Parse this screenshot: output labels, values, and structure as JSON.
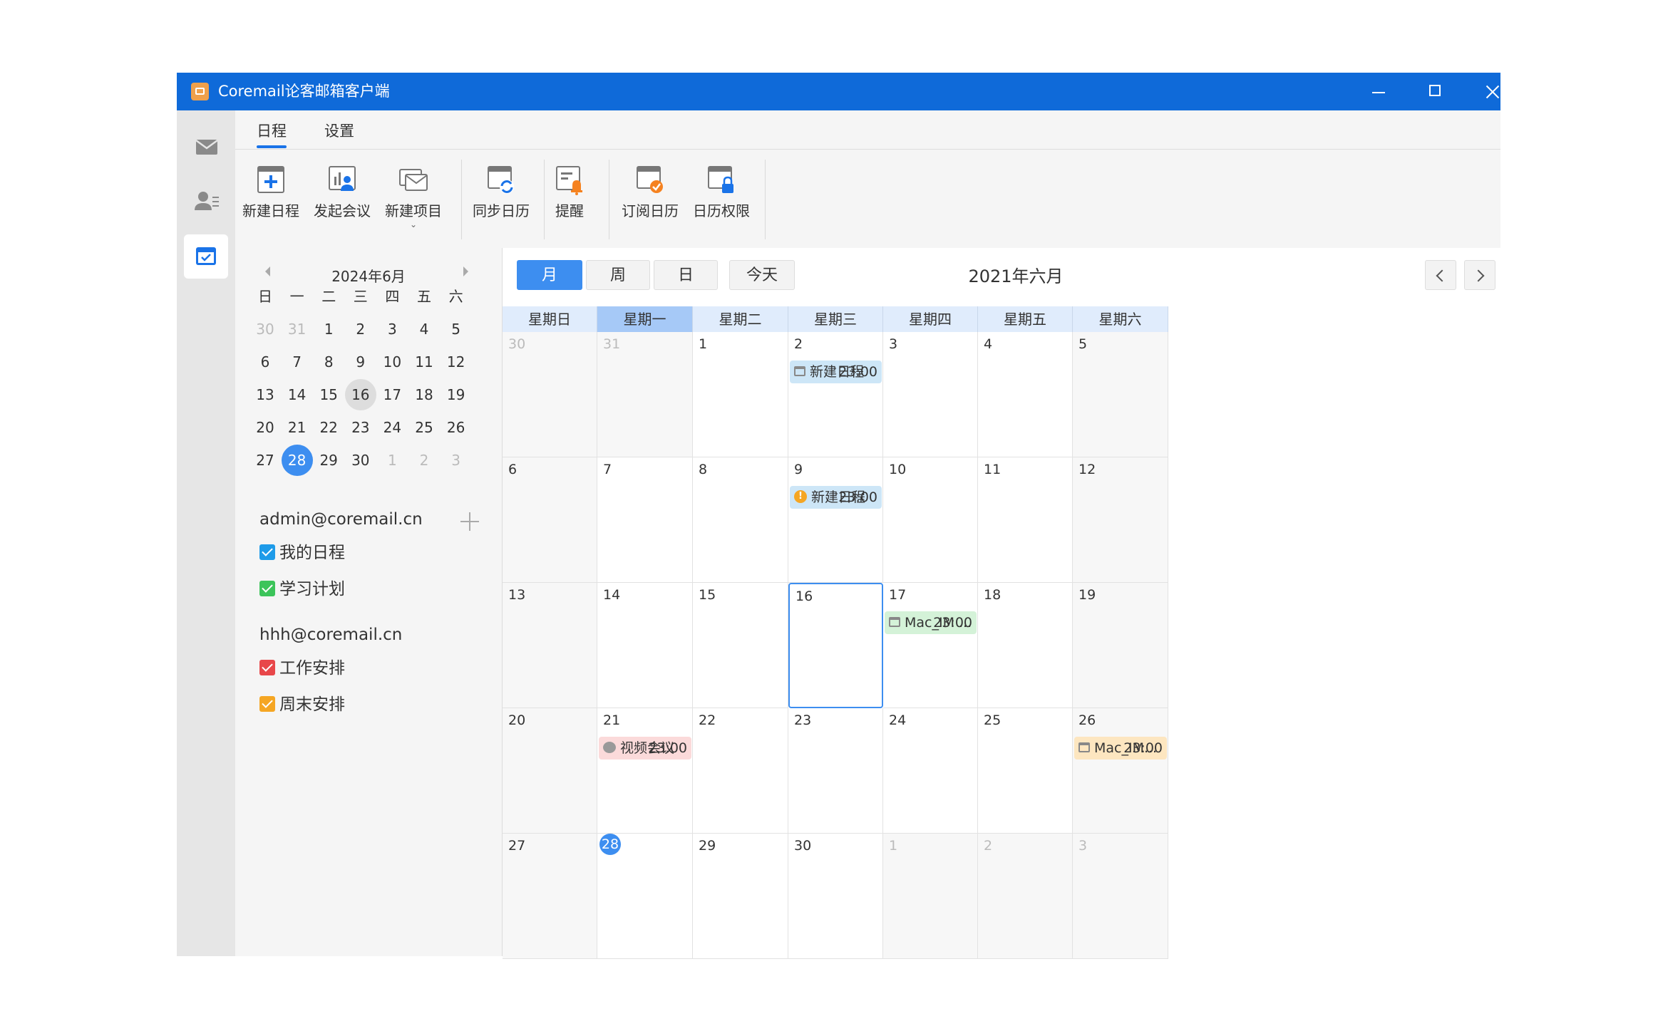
{
  "app": {
    "title": "Coremail论客邮箱客户端"
  },
  "tabs": [
    {
      "label": "日程"
    },
    {
      "label": "设置"
    }
  ],
  "toolbar": [
    {
      "label": "新建日程",
      "icon": "new-schedule-icon"
    },
    {
      "label": "发起会议",
      "icon": "start-meeting-icon"
    },
    {
      "label": "新建项目",
      "icon": "new-item-icon"
    },
    {
      "label": "同步日历",
      "icon": "sync-calendar-icon"
    },
    {
      "label": "提醒",
      "icon": "reminder-bell-icon"
    },
    {
      "label": "订阅日历",
      "icon": "subscribe-calendar-icon"
    },
    {
      "label": "日历权限",
      "icon": "calendar-permission-lock-icon"
    }
  ],
  "mini_calendar": {
    "title": "2024年6月",
    "weekdays": [
      "日",
      "一",
      "二",
      "三",
      "四",
      "五",
      "六"
    ],
    "weeks": [
      [
        "30",
        "31",
        "1",
        "2",
        "3",
        "4",
        "5"
      ],
      [
        "6",
        "7",
        "8",
        "9",
        "10",
        "11",
        "12"
      ],
      [
        "13",
        "14",
        "15",
        "16",
        "17",
        "18",
        "19"
      ],
      [
        "20",
        "21",
        "22",
        "23",
        "24",
        "25",
        "26"
      ],
      [
        "27",
        "28",
        "29",
        "30",
        "1",
        "2",
        "3"
      ]
    ],
    "selected": "16",
    "today": "28"
  },
  "accounts": [
    {
      "email": "admin@coremail.cn",
      "calendars": [
        {
          "name": "我的日程",
          "color": "#1e9be9"
        },
        {
          "name": "学习计划",
          "color": "#3cc45a"
        }
      ]
    },
    {
      "email": "hhh@coremail.cn",
      "calendars": [
        {
          "name": "工作安排",
          "color": "#e8474a"
        },
        {
          "name": "周末安排",
          "color": "#f5a623"
        }
      ]
    }
  ],
  "view_buttons": [
    "月",
    "周",
    "日"
  ],
  "today_button": "今天",
  "month_title": "2021年六月",
  "weekday_headers": [
    "星期日",
    "星期一",
    "星期二",
    "星期三",
    "星期四",
    "星期五",
    "星期六"
  ],
  "month_grid": [
    [
      "30",
      "31",
      "1",
      "2",
      "3",
      "4",
      "5"
    ],
    [
      "6",
      "7",
      "8",
      "9",
      "10",
      "11",
      "12"
    ],
    [
      "13",
      "14",
      "15",
      "16",
      "17",
      "18",
      "19"
    ],
    [
      "20",
      "21",
      "22",
      "23",
      "24",
      "25",
      "26"
    ],
    [
      "27",
      "28",
      "29",
      "30",
      "1",
      "2",
      "3"
    ]
  ],
  "events": [
    {
      "week": 0,
      "day": 3,
      "title": "新建日程",
      "time": "23:00",
      "color": "#cde6f7",
      "icon": "calendar-icon"
    },
    {
      "week": 1,
      "day": 3,
      "title": "新建日程",
      "time": "23:00",
      "color": "#cde6f7",
      "icon": "warning-icon"
    },
    {
      "week": 2,
      "day": 4,
      "title": "Mac_IM ...",
      "time": "23:00",
      "color": "#d4f2d8",
      "icon": "calendar-icon"
    },
    {
      "week": 3,
      "day": 1,
      "title": "视频会议",
      "time": "23:00",
      "color": "#fbdada",
      "icon": "video-chat-icon"
    },
    {
      "week": 3,
      "day": 6,
      "title": "Mac_IM...",
      "time": "23:00",
      "color": "#fde6c0",
      "icon": "calendar-icon"
    }
  ]
}
